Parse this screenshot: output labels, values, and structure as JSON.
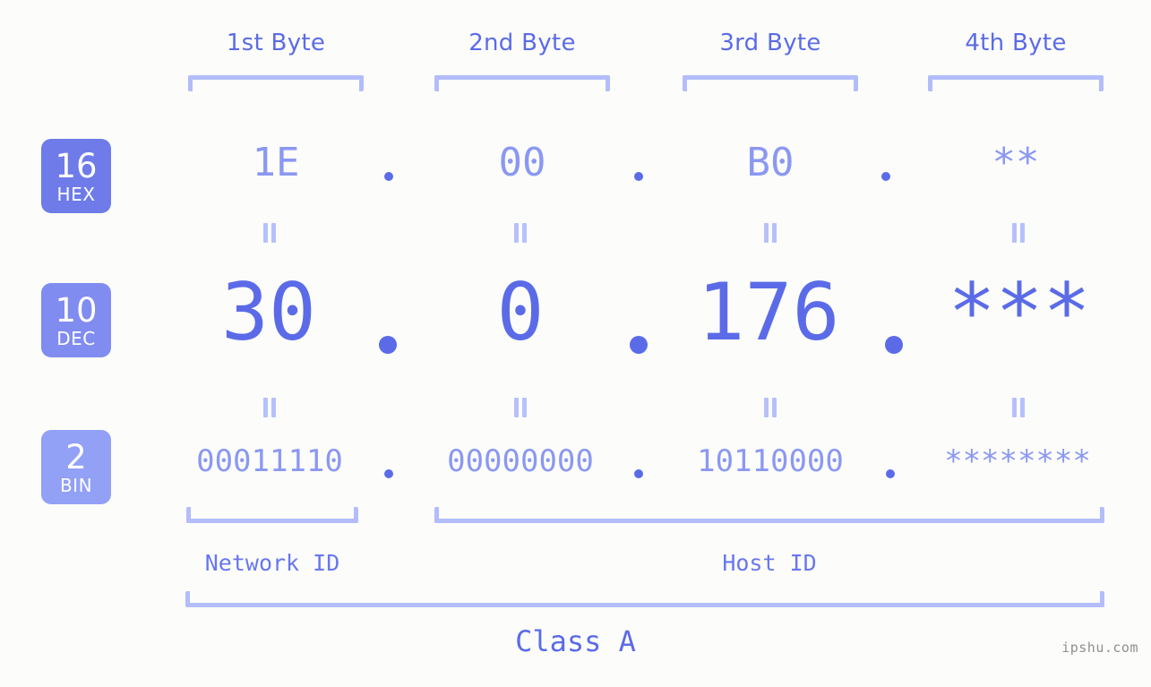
{
  "watermark": "ipshu.com",
  "class_label": "Class A",
  "byte_headers": [
    {
      "label": "1st Byte"
    },
    {
      "label": "2nd Byte"
    },
    {
      "label": "3rd Byte"
    },
    {
      "label": "4th Byte"
    }
  ],
  "bases": [
    {
      "number": "16",
      "name": "HEX",
      "color": "#6e7be8"
    },
    {
      "number": "10",
      "name": "DEC",
      "color": "#808cf0"
    },
    {
      "number": "2",
      "name": "BIN",
      "color": "#92a0f5"
    }
  ],
  "rows": {
    "hex": {
      "base": "16",
      "values": [
        "1E",
        "00",
        "B0",
        "**"
      ]
    },
    "dec": {
      "base": "10",
      "values": [
        "30",
        "0",
        "176",
        "***"
      ]
    },
    "bin": {
      "base": "2",
      "values": [
        "00011110",
        "00000000",
        "10110000",
        "********"
      ]
    }
  },
  "separator": ".",
  "equals_symbol": "=",
  "sections": {
    "network_id": "Network ID",
    "host_id": "Host ID"
  },
  "colors": {
    "background": "#fcfdfa",
    "accent_strong": "#5b6be8",
    "accent_light": "#8b98f2",
    "bracket": "#b3bdfb",
    "watermark": "#8f8f8f"
  }
}
